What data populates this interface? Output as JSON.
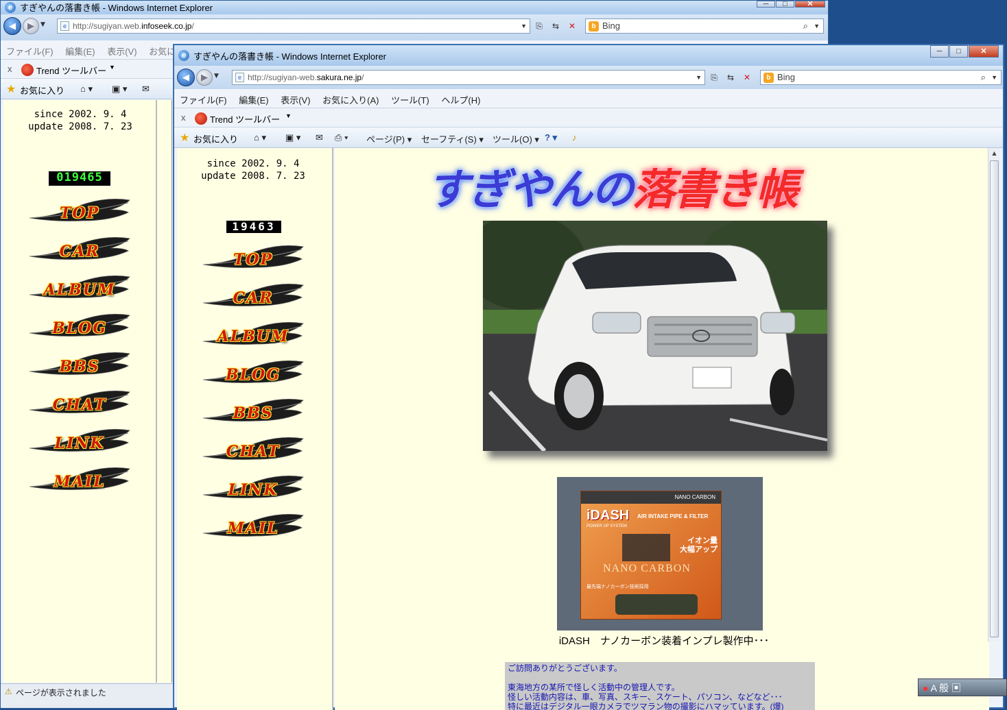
{
  "back_window": {
    "title": "すぎやんの落書き帳 - Windows Internet Explorer",
    "url_prefix": "http://sugiyan.web.",
    "url_host": "infoseek.co.jp",
    "url_suffix": "/",
    "search_engine": "Bing",
    "menu": [
      "ファイル(F)",
      "編集(E)",
      "表示(V)",
      "お気に入"
    ],
    "trend_toolbar": "Trend ツールバー",
    "favorites": "お気に入り",
    "since": "since  2002. 9. 4",
    "update": "update  2008. 7. 23",
    "counter": "019465",
    "nav": [
      "TOP",
      "CAR",
      "ALBUM",
      "BLOG",
      "BBS",
      "CHAT",
      "LINK",
      "MAIL"
    ],
    "status": "ページが表示されました"
  },
  "front_window": {
    "title": "すぎやんの落書き帳 - Windows Internet Explorer",
    "url_prefix": "http://sugiyan-web.",
    "url_host": "sakura.ne.jp",
    "url_suffix": "/",
    "search_engine": "Bing",
    "menu": [
      "ファイル(F)",
      "編集(E)",
      "表示(V)",
      "お気に入り(A)",
      "ツール(T)",
      "ヘルプ(H)"
    ],
    "trend_toolbar": "Trend ツールバー",
    "favorites": "お気に入り",
    "commands": [
      "ページ(P)",
      "セーフティ(S)",
      "ツール(O)"
    ],
    "since": "since  2002. 9. 4",
    "update": "update  2008. 7. 23",
    "counter": "19463",
    "nav": [
      "TOP",
      "CAR",
      "ALBUM",
      "BLOG",
      "BBS",
      "CHAT",
      "LINK",
      "MAIL"
    ],
    "site_title_a": "すぎやんの",
    "site_title_b": "落書き帳",
    "product": {
      "brand_line": "NANO CARBON",
      "name": "iDASH",
      "tagline": "AIR INTAKE PIPE & FILTER",
      "sub": "POWER UP SYSTEM",
      "jp_badge_1": "イオン量",
      "jp_badge_2": "大幅アップ",
      "mid_text": "NANO CARBON",
      "bottom_jp": "最先端ナノカーボン技術採用"
    },
    "caption": "iDASH　ナノカーボン装着インプレ製作中･･･",
    "greeting": [
      "ご訪問ありがとうございます。",
      "",
      "東海地方の某所で怪しく活動中の管理人です。",
      "怪しい活動内容は、車、写真、スキー、スケート、パソコン、などなど･･･",
      "特に最近はデジタル一眼カメラでツマラン物の撮影にハマッています。(爆)"
    ]
  },
  "colors": {
    "page_bg": "#ffffe4",
    "nav_red": "#cc1a06",
    "nav_yellow": "#ffee3a",
    "title_blue": "#3b3bd6",
    "title_red": "#f42a2a",
    "greet_text": "#1515b0",
    "greet_bg": "#c9c9c9"
  },
  "taskbar": {
    "ime": "A 般"
  }
}
